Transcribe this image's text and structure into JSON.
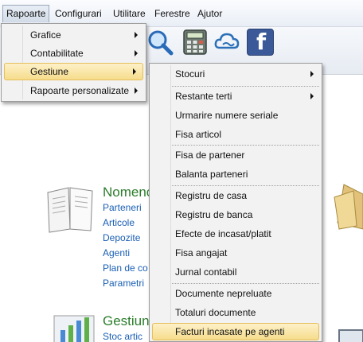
{
  "menubar": {
    "items": [
      "Rapoarte",
      "Configurari",
      "Utilitare",
      "Ferestre",
      "Ajutor"
    ]
  },
  "menu_rapoarte": {
    "items": [
      "Grafice",
      "Contabilitate",
      "Gestiune",
      "Rapoarte personalizate"
    ],
    "highlighted": "Gestiune"
  },
  "menu_gestiune": {
    "items": [
      "Stocuri",
      "Restante terti",
      "Urmarire numere seriale",
      "Fisa articol",
      "Fisa de partener",
      "Balanta parteneri",
      "Registru de casa",
      "Registru de banca",
      "Efecte de incasat/platit",
      "Fisa angajat",
      "Jurnal contabil",
      "Documente nepreluate",
      "Totaluri documente",
      "Facturi incasate pe agenti"
    ],
    "highlighted": "Facturi incasate pe agenti"
  },
  "content": {
    "nomenclatoare": {
      "title": "Nomenc",
      "links": [
        "Parteneri",
        "Articole",
        "Depozite",
        "Agenti",
        "Plan de co",
        "Parametri"
      ]
    },
    "gestiune": {
      "title": "Gestiun",
      "links": [
        "Stoc artic"
      ]
    }
  },
  "toolbar": {
    "icons": [
      "search-icon",
      "calculator-icon",
      "cloud-icon",
      "facebook-icon"
    ],
    "facebook_letter": "f"
  },
  "colors": {
    "menu_highlight": "#f6dc8b",
    "section_title": "#2b7d2b",
    "link": "#1a5fb4"
  }
}
